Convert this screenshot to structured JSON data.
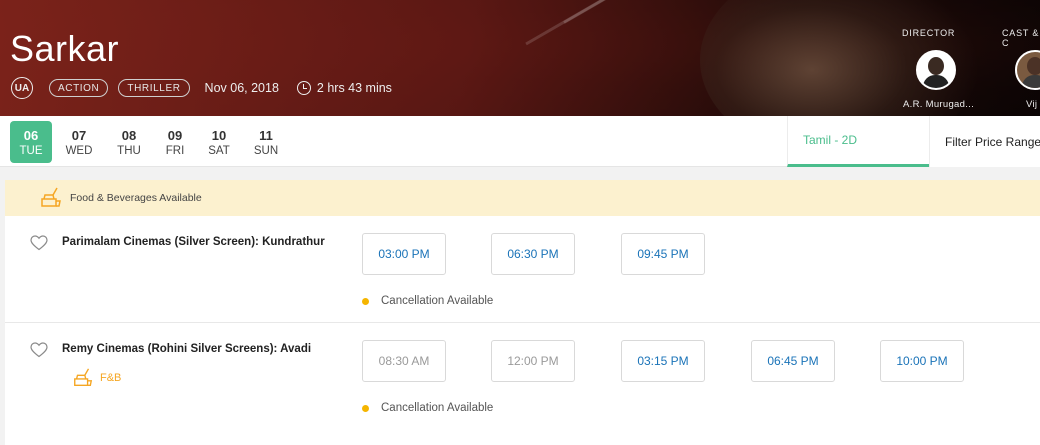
{
  "movie": {
    "title": "Sarkar",
    "certificate": "UA",
    "genres": [
      "ACTION",
      "THRILLER"
    ],
    "release_date": "Nov 06, 2018",
    "duration": "2 hrs 43 mins"
  },
  "crew": {
    "director_label": "DIRECTOR",
    "director_name": "A.R. Murugad...",
    "cast_label": "CAST & C",
    "cast_name": "Vij"
  },
  "dates": [
    {
      "num": "06",
      "day": "TUE",
      "active": true
    },
    {
      "num": "07",
      "day": "WED",
      "active": false
    },
    {
      "num": "08",
      "day": "THU",
      "active": false
    },
    {
      "num": "09",
      "day": "FRI",
      "active": false
    },
    {
      "num": "10",
      "day": "SAT",
      "active": false
    },
    {
      "num": "11",
      "day": "SUN",
      "active": false
    }
  ],
  "language_tab": "Tamil - 2D",
  "filter_label": "Filter Price Range",
  "fnb_banner": "Food & Beverages Available",
  "cinemas": [
    {
      "name": "Parimalam Cinemas (Silver Screen): Kundrathur",
      "showtimes": [
        {
          "time": "03:00 PM",
          "available": true
        },
        {
          "time": "06:30 PM",
          "available": true
        },
        {
          "time": "09:45 PM",
          "available": true
        }
      ],
      "cancellation": "Cancellation Available",
      "fnb": ""
    },
    {
      "name": "Remy Cinemas (Rohini Silver Screens): Avadi",
      "showtimes": [
        {
          "time": "08:30 AM",
          "available": false
        },
        {
          "time": "12:00 PM",
          "available": false
        },
        {
          "time": "03:15 PM",
          "available": true
        },
        {
          "time": "06:45 PM",
          "available": true
        },
        {
          "time": "10:00 PM",
          "available": true
        }
      ],
      "cancellation": "Cancellation Available",
      "fnb": "F&B"
    }
  ],
  "colors": {
    "accent": "#4abd8c",
    "showtime_text": "#1a73b8",
    "disabled_text": "#9a9a9a",
    "fnb_orange": "#f5a623",
    "cancel_dot": "#f5b500",
    "banner_bg": "#fcf1cf"
  }
}
